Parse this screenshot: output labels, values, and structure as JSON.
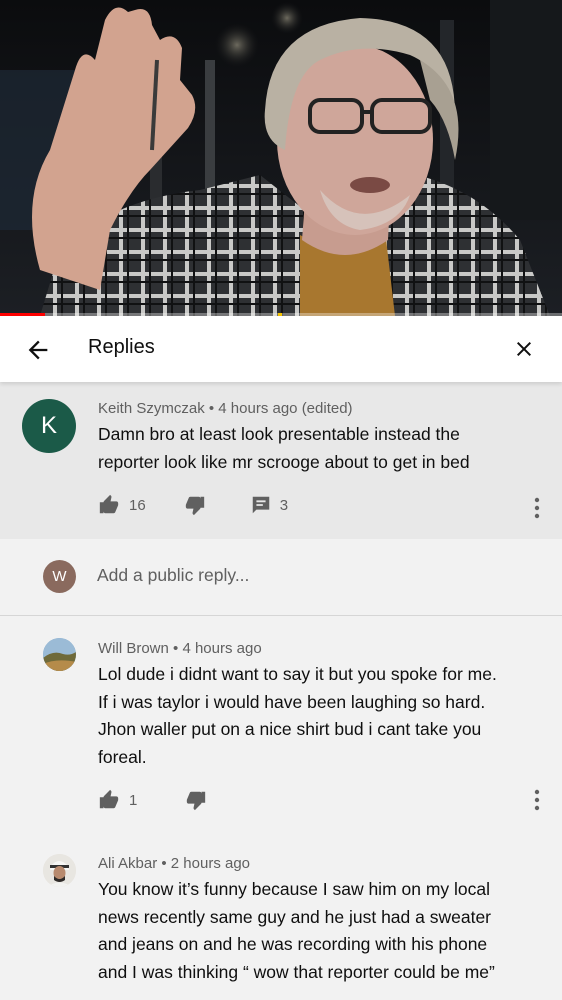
{
  "header": {
    "title": "Replies"
  },
  "video": {
    "progress": 0.08,
    "accent": "#ff0000"
  },
  "parent_comment": {
    "avatar_letter": "K",
    "avatar_color": "#1b5a48",
    "author": "Keith Szymczak",
    "time": "4 hours ago (edited)",
    "text_line1": "Damn bro at least look presentable instead the",
    "text_line2": "reporter look like mr scrooge about to get in bed",
    "likes": "16",
    "reply_count": "3"
  },
  "add_reply": {
    "avatar_letter": "W",
    "placeholder": "Add a public reply..."
  },
  "replies": [
    {
      "author": "Will Brown",
      "time": "4 hours ago",
      "lines": [
        "Lol dude i didnt want to say it but you spoke for me.",
        "If i was taylor i would have been laughing so hard.",
        "Jhon waller put on a nice shirt bud i cant take you",
        "foreal."
      ],
      "likes": "1"
    },
    {
      "author": "Ali Akbar",
      "time": "2 hours ago",
      "lines": [
        "You know it’s funny because I saw him on my local",
        "news recently same guy and he just had a sweater",
        "and jeans on and he was recording with his phone",
        "and I was thinking  “ wow that reporter could be me”"
      ]
    }
  ]
}
